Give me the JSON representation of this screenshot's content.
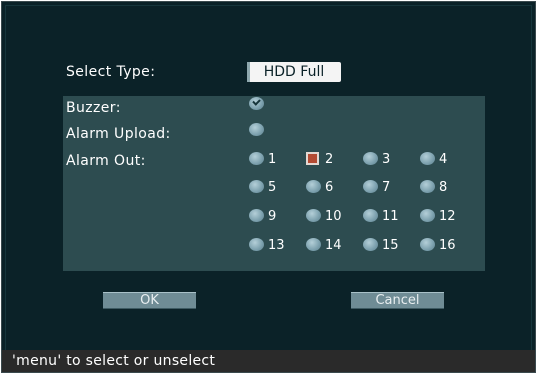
{
  "select_type": {
    "label": "Select Type:",
    "value": "HDD Full"
  },
  "buzzer": {
    "label": "Buzzer:",
    "checked": true
  },
  "alarm_upload": {
    "label": "Alarm Upload:",
    "checked": false
  },
  "alarm_out": {
    "label": "Alarm Out:",
    "channels": [
      "1",
      "2",
      "3",
      "4",
      "5",
      "6",
      "7",
      "8",
      "9",
      "10",
      "11",
      "12",
      "13",
      "14",
      "15",
      "16"
    ],
    "selected": "2"
  },
  "buttons": {
    "ok": "OK",
    "cancel": "Cancel"
  },
  "status_bar": "'menu' to select or unselect"
}
